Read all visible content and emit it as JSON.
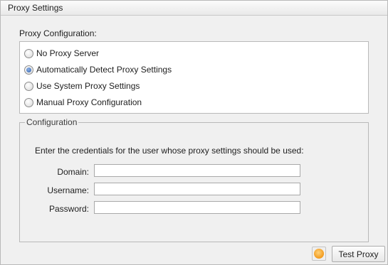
{
  "panel": {
    "title": "Proxy Settings"
  },
  "proxy_configuration": {
    "label": "Proxy Configuration:",
    "options": [
      {
        "label": "No Proxy Server",
        "checked": false
      },
      {
        "label": "Automatically Detect Proxy Settings",
        "checked": true
      },
      {
        "label": "Use System Proxy Settings",
        "checked": false
      },
      {
        "label": "Manual Proxy Configuration",
        "checked": false
      }
    ]
  },
  "configuration": {
    "legend": "Configuration",
    "instructions": "Enter the credentials for the user whose proxy settings should be used:",
    "fields": {
      "domain": {
        "label": "Domain:",
        "value": ""
      },
      "username": {
        "label": "Username:",
        "value": ""
      },
      "password": {
        "label": "Password:",
        "value": ""
      }
    }
  },
  "footer": {
    "status_icon": "orange-status-circle-icon",
    "status_color": "#f29a1c",
    "test_button_label": "Test Proxy"
  }
}
